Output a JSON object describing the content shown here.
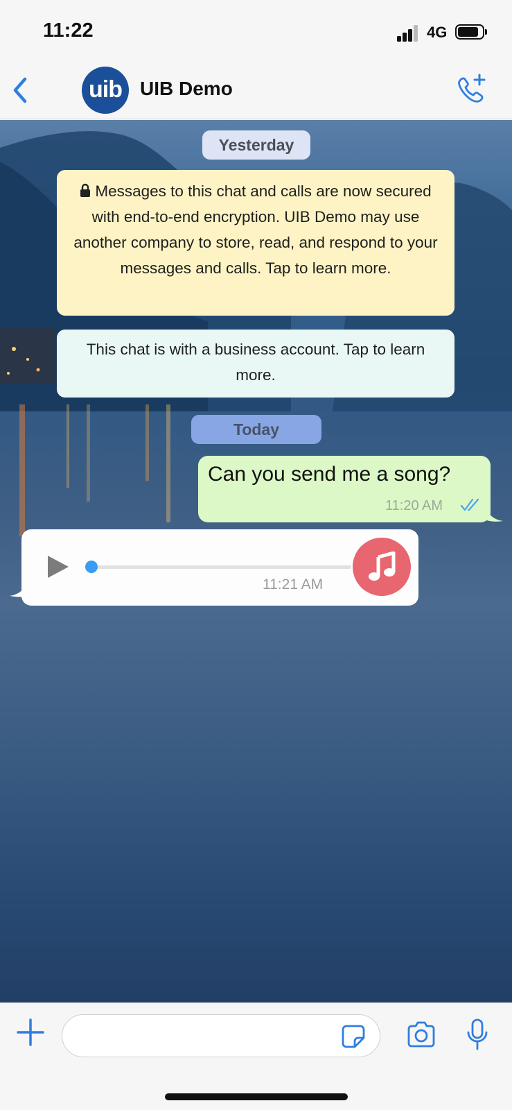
{
  "status_bar": {
    "time": "11:22",
    "network": "4G",
    "battery_level": 0.85
  },
  "header": {
    "avatar_text": "uib",
    "contact_name": "UIB Demo"
  },
  "chat": {
    "date_yesterday": "Yesterday",
    "encryption_notice": "Messages to this chat and calls are now secured with end-to-end encryption. UIB Demo may use another company to store, read, and respond to your messages and calls. Tap to learn more.",
    "business_notice": "This chat is with a business account. Tap to learn more.",
    "date_today": "Today",
    "outgoing": {
      "text": "Can you send me a song?",
      "time": "11:20 AM"
    },
    "incoming_audio": {
      "time": "11:21 AM",
      "progress": 0
    }
  },
  "input": {
    "value": "",
    "placeholder": ""
  },
  "colors": {
    "accent": "#2f7ee0",
    "outgoing_bubble": "#dcf8c6",
    "notice_yellow": "#fdf3c4",
    "notice_mint": "#eaf8f5",
    "music_avatar": "#e86670",
    "today_chip": "#87a6e3"
  },
  "icons": [
    "back-chevron-icon",
    "phone-plus-icon",
    "lock-icon",
    "double-check-icon",
    "play-icon",
    "music-note-icon",
    "plus-icon",
    "sticker-icon",
    "camera-icon",
    "microphone-icon"
  ]
}
